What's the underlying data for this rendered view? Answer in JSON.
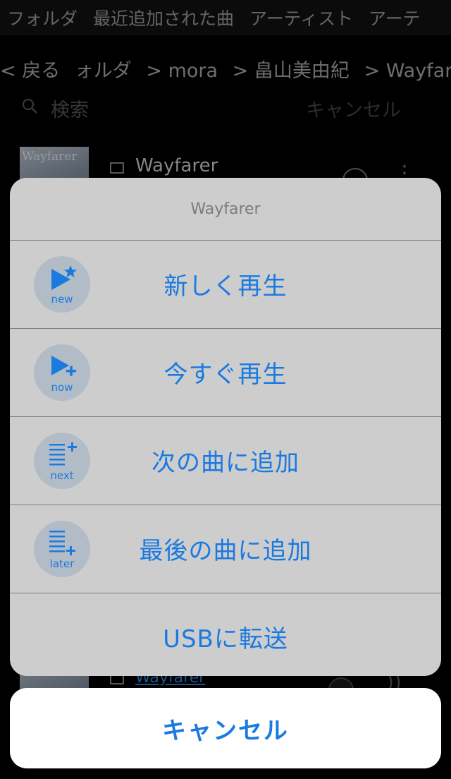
{
  "tabs": [
    "フォルダ",
    "最近追加された曲",
    "アーティスト",
    "アーテ"
  ],
  "breadcrumb": {
    "back": "< 戻る",
    "path": [
      "ォルダ",
      "> mora",
      "> 畠山美由紀",
      "> Wayfarer"
    ]
  },
  "search": {
    "placeholder": "検索",
    "cancel": "キャンセル"
  },
  "list": [
    {
      "art_text": "Wayfarer",
      "title": "Wayfarer"
    },
    {
      "art_text": "",
      "title": "Wayfarer"
    }
  ],
  "sheet": {
    "title": "Wayfarer",
    "items": [
      {
        "icon": "play-new-icon",
        "icon_text": "new",
        "label": "新しく再生"
      },
      {
        "icon": "play-now-icon",
        "icon_text": "now",
        "label": "今すぐ再生"
      },
      {
        "icon": "queue-next-icon",
        "icon_text": "next",
        "label": "次の曲に追加"
      },
      {
        "icon": "queue-later-icon",
        "icon_text": "later",
        "label": "最後の曲に追加"
      },
      {
        "icon": "",
        "icon_text": "",
        "label": "USBに転送"
      }
    ],
    "cancel": "キャンセル"
  },
  "colors": {
    "accent": "#1a7ae0",
    "sheet_bg": "#cdcdcd",
    "icon_bg": "#b2bcc6"
  }
}
